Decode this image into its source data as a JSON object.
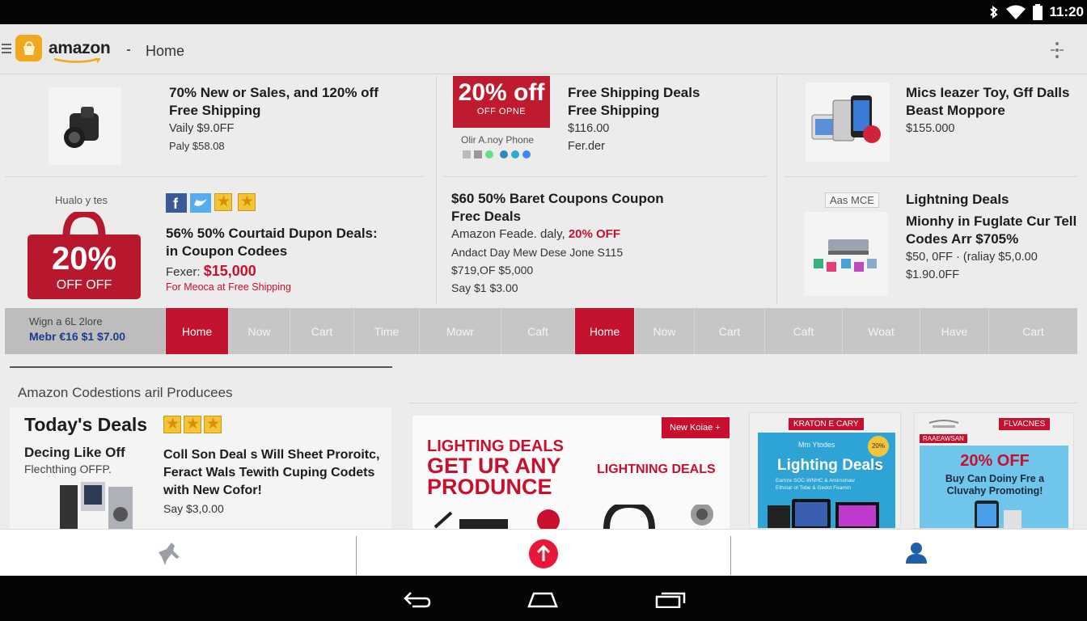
{
  "status": {
    "time": "11:20"
  },
  "header": {
    "brand": "amazon",
    "title": "Home"
  },
  "deals_top": [
    {
      "title1": "70% New or Sales, and 120% off",
      "title2": "Free Shipping",
      "line1": "Vaily $9.0FF",
      "line2": "Paly $58.08"
    },
    {
      "badge": "20% off",
      "badge_sub": "OFF OPNE",
      "thumb_caption": "Olir A.noy Phone",
      "title1": "Free Shipping Deals",
      "title2": "Free Shipping",
      "line1": "$116.00",
      "line2": "Fer.der"
    },
    {
      "title1": "Mics Ieazer Toy, Gff Dalls",
      "title2": "Beast Moppore",
      "line1": "$155.000"
    }
  ],
  "deals_mid": [
    {
      "thumb_label": "Hualo y tes",
      "badge_big": "20%",
      "badge_sub": "OFF OFF",
      "title1": "56% 50% Courtaid Dupon Deals:",
      "title2": "in Coupon Codees",
      "price_label": "Fexer: ",
      "price": "$15,000",
      "promo": "For Meoca at Free Shipping"
    },
    {
      "title1": "$60 50% Baret Coupons Coupon",
      "title2": "Frec Deals",
      "line1_pre": "Amazon Feade. daly, ",
      "line1_red": "20% OFF",
      "line2": "Andact Day Mew Dese Jone S115",
      "line3": "$719,OF $5,000",
      "line4": "Say $1 $3.00"
    },
    {
      "thumb_label": "Aas MCE",
      "title1": "Lightning Deals",
      "title2": "Mionhy in Fuglate Cur Tell",
      "title3": "Codes Arr $705%",
      "line1": "$50, 0FF · (raliay $5,0.00",
      "line2": "$1.90.0FF"
    }
  ],
  "strip": {
    "left_line1": "Wign a 6L 2lore",
    "left_line2": "Mebr €16 $1 $7.00",
    "tabs": [
      "Home",
      "Now",
      "Cart",
      "Time",
      "Mowr",
      "Caft",
      "Home",
      "Now",
      "Cart",
      "Caft",
      "Woat",
      "Have",
      "Cart"
    ]
  },
  "section": {
    "title": "Amazon Codestions aril Producees"
  },
  "todays": {
    "title": "Today's Deals",
    "left_title": "Decing Like Off",
    "left_sub": "Flechthing OFFP.",
    "r1": "Coll Son Deal s Will Sheet Proroitc,",
    "r2": "Feract Wals Tewith Cuping Codets",
    "r3": "with New Cofor!",
    "r4": "Say $3,0.00"
  },
  "banner1": {
    "l1": "LIGHTING DEALS",
    "l2": "GET UR ANY",
    "l3": "PRODUNCE",
    "right": "LIGHTNING DEALS",
    "tag": "New Koiae +"
  },
  "banner2": {
    "top": "KRATON E CARY",
    "title": "Lighting Deals",
    "sub": "Eamze SOC-WNHC & Amirsshaw",
    "sub2": "Ethoiar ot Tobe & Gedot Feamm",
    "badge": "20% off",
    "small": "Mm Ytodes"
  },
  "banner3": {
    "top": "FLVACNES",
    "red_small": "RAAEAWSAN",
    "title": "20% OFF",
    "l1": "Buy Can Doiny Fre a",
    "l2": "Cluvahy Promoting!"
  },
  "colors": {
    "accent": "#c2122f",
    "brand": "#f0a81e"
  }
}
